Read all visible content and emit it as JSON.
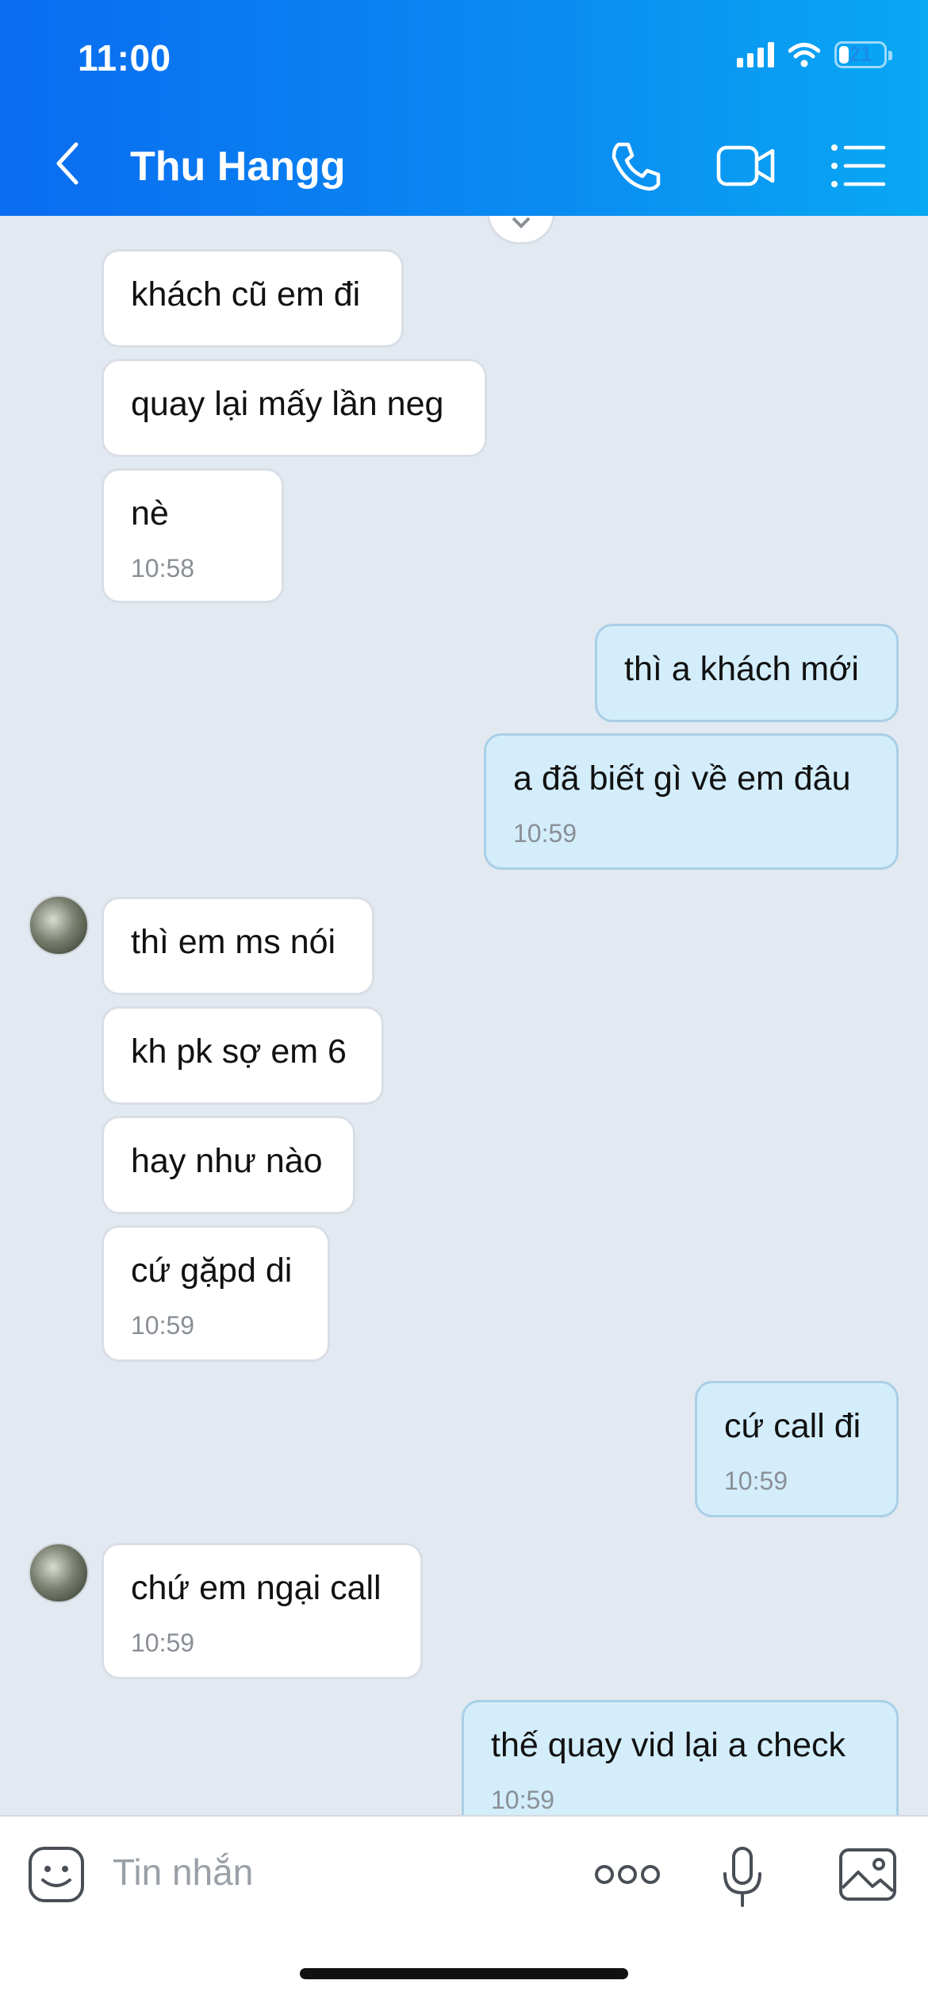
{
  "status": {
    "time": "11:00",
    "battery": "21"
  },
  "header": {
    "title": "Thu Hangg"
  },
  "messages": [
    {
      "dir": "in",
      "text": "khách cũ em đi",
      "time": ""
    },
    {
      "dir": "in",
      "text": "quay lại mấy lần neg",
      "time": ""
    },
    {
      "dir": "in",
      "text": "nè",
      "time": "10:58"
    },
    {
      "dir": "out",
      "text": "thì a khách mới",
      "time": ""
    },
    {
      "dir": "out",
      "text": "a đã biết gì về em đâu",
      "time": "10:59"
    },
    {
      "dir": "in",
      "text": "thì em ms nói",
      "time": ""
    },
    {
      "dir": "in",
      "text": "kh pk sợ em 6",
      "time": ""
    },
    {
      "dir": "in",
      "text": "hay như nào",
      "time": ""
    },
    {
      "dir": "in",
      "text": "cứ gặpd di",
      "time": "10:59"
    },
    {
      "dir": "out",
      "text": "cứ call đi",
      "time": "10:59"
    },
    {
      "dir": "in",
      "text": "chứ em ngại call",
      "time": "10:59"
    },
    {
      "dir": "out",
      "text": "thế quay vid lại a check",
      "time": "10:59"
    }
  ],
  "composer": {
    "placeholder": "Tin nhắn"
  },
  "icons": {
    "back": "chevron-left-icon",
    "call": "phone-icon",
    "video": "video-camera-icon",
    "menu": "list-icon",
    "sticker": "sticker-face-icon",
    "more": "more-dots-icon",
    "mic": "microphone-icon",
    "image": "image-icon"
  },
  "colors": {
    "header_start": "#0a6cf0",
    "header_end": "#09a8f3",
    "outgoing_bubble": "#d3edfb",
    "incoming_bubble": "#ffffff",
    "chat_bg": "#e2e9f1"
  }
}
